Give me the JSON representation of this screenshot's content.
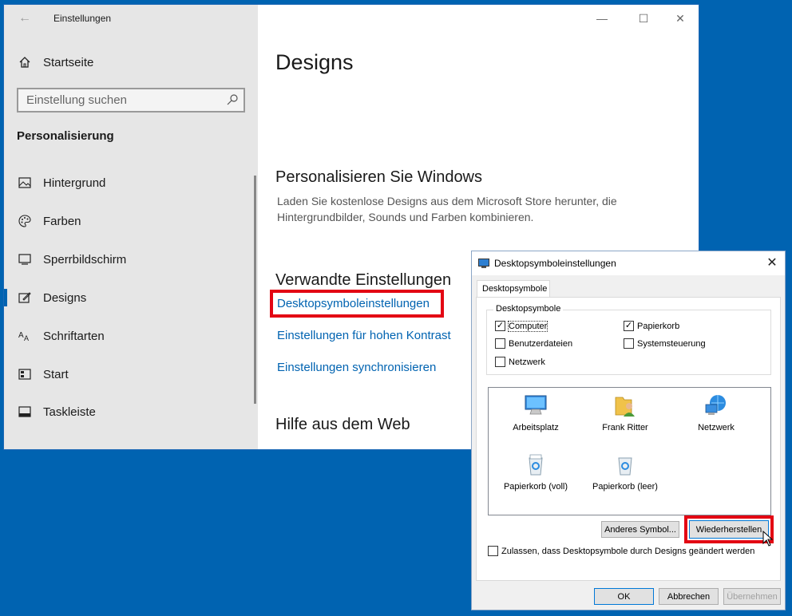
{
  "settings": {
    "app_title": "Einstellungen",
    "home_label": "Startseite",
    "search_placeholder": "Einstellung suchen",
    "section_title": "Personalisierung",
    "nav": [
      {
        "label": "Hintergrund",
        "icon": "picture-icon"
      },
      {
        "label": "Farben",
        "icon": "palette-icon"
      },
      {
        "label": "Sperrbildschirm",
        "icon": "lock-screen-icon"
      },
      {
        "label": "Designs",
        "icon": "designs-icon",
        "active": true
      },
      {
        "label": "Schriftarten",
        "icon": "fonts-icon"
      },
      {
        "label": "Start",
        "icon": "start-icon"
      },
      {
        "label": "Taskleiste",
        "icon": "taskbar-icon"
      }
    ],
    "page_title": "Designs",
    "personalize_heading": "Personalisieren Sie Windows",
    "personalize_desc": "Laden Sie kostenlose Designs aus dem Microsoft Store herunter, die Hintergrundbilder, Sounds und Farben kombinieren.",
    "related_heading": "Verwandte Einstellungen",
    "links": [
      "Desktopsymboleinstellungen",
      "Einstellungen für hohen Kontrast",
      "Einstellungen synchronisieren"
    ],
    "help_heading": "Hilfe aus dem Web",
    "accent_color": "#0063b1"
  },
  "dialog": {
    "title": "Desktopsymboleinstellungen",
    "tab_label": "Desktopsymbole",
    "group_label": "Desktopsymbole",
    "checkboxes": [
      {
        "label": "Computer",
        "checked": true
      },
      {
        "label": "Papierkorb",
        "checked": true
      },
      {
        "label": "Benutzerdateien",
        "checked": false
      },
      {
        "label": "Systemsteuerung",
        "checked": false
      },
      {
        "label": "Netzwerk",
        "checked": false
      }
    ],
    "icons": [
      {
        "label": "Arbeitsplatz",
        "icon": "computer-icon"
      },
      {
        "label": "Frank Ritter",
        "icon": "user-folder-icon"
      },
      {
        "label": "Netzwerk",
        "icon": "network-icon"
      },
      {
        "label": "Papierkorb (voll)",
        "icon": "recycle-bin-full-icon"
      },
      {
        "label": "Papierkorb (leer)",
        "icon": "recycle-bin-empty-icon"
      }
    ],
    "change_icon_button": "Anderes Symbol...",
    "restore_button": "Wiederherstellen",
    "allow_themes_label": "Zulassen, dass Desktopsymbole durch Designs geändert werden",
    "allow_themes_checked": false,
    "ok_button": "OK",
    "cancel_button": "Abbrechen",
    "apply_button": "Übernehmen"
  },
  "highlight_color": "#e30613"
}
